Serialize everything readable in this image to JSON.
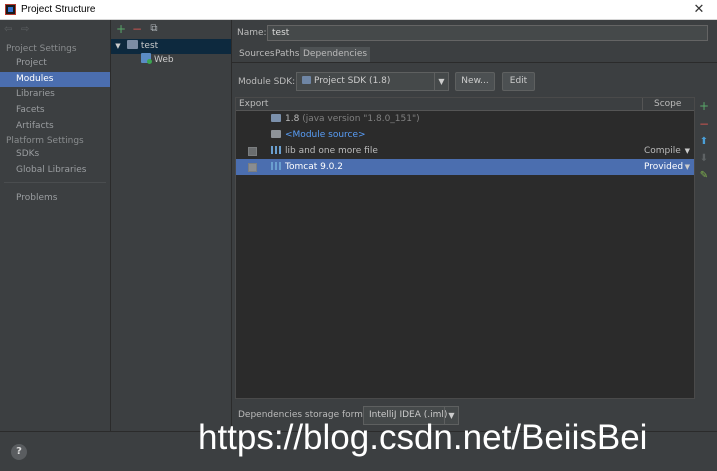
{
  "window": {
    "title": "Project Structure",
    "close_glyph": "✕",
    "accent_color": "#4b6eaf"
  },
  "nav": {
    "back_glyph": "⇦",
    "forward_glyph": "⇨",
    "project_settings_title": "Project Settings",
    "project_settings_items": [
      {
        "label": "Project",
        "selected": false
      },
      {
        "label": "Modules",
        "selected": true
      },
      {
        "label": "Libraries",
        "selected": false
      },
      {
        "label": "Facets",
        "selected": false
      },
      {
        "label": "Artifacts",
        "selected": false
      }
    ],
    "platform_settings_title": "Platform Settings",
    "platform_settings_items": [
      {
        "label": "SDKs"
      },
      {
        "label": "Global Libraries"
      }
    ],
    "problems_label": "Problems"
  },
  "tree": {
    "toolbar": {
      "add_glyph": "+",
      "remove_glyph": "−",
      "copy_glyph": "⧉"
    },
    "root": {
      "expander": "▼",
      "label": "test"
    },
    "children": [
      {
        "label": "Web"
      }
    ]
  },
  "module": {
    "name_label": "Name:",
    "name_value": "test",
    "tabs": [
      {
        "label": "Sources",
        "active": false
      },
      {
        "label": "Paths",
        "active": false
      },
      {
        "label": "Dependencies",
        "active": true
      }
    ],
    "sdk_label": "Module SDK:",
    "sdk_value": "Project SDK (1.8)",
    "sdk_arrow": "▼",
    "new_button": "New...",
    "edit_button": "Edit"
  },
  "dependencies": {
    "columns": {
      "export": "Export",
      "scope": "Scope"
    },
    "rows": [
      {
        "name": "1.8",
        "detail": "(java version \"1.8.0_151\")",
        "checkbox": false,
        "scope": "",
        "selected": false,
        "icon": "sdk-folder-icon"
      },
      {
        "name": "<Module source>",
        "detail": "",
        "checkbox": false,
        "scope": "",
        "selected": false,
        "icon": "source-folder-icon"
      },
      {
        "name": "lib and one more file",
        "detail": "",
        "checkbox": true,
        "scope": "Compile",
        "selected": false,
        "icon": "library-icon"
      },
      {
        "name": "Tomcat 9.0.2",
        "detail": "",
        "checkbox": true,
        "scope": "Provided",
        "selected": true,
        "icon": "library-icon"
      }
    ],
    "scope_arrow": "▼",
    "side_tools": {
      "add": "+",
      "remove": "−",
      "move_up": "⬆",
      "move_down": "⬇",
      "edit": "✎"
    },
    "storage_format_label": "Dependencies storage format:",
    "storage_format_value": "IntelliJ IDEA (.iml)",
    "storage_arrow": "▼"
  },
  "footer": {
    "help_glyph": "?",
    "watermark": "https://blog.csdn.net/BeiisBei"
  }
}
